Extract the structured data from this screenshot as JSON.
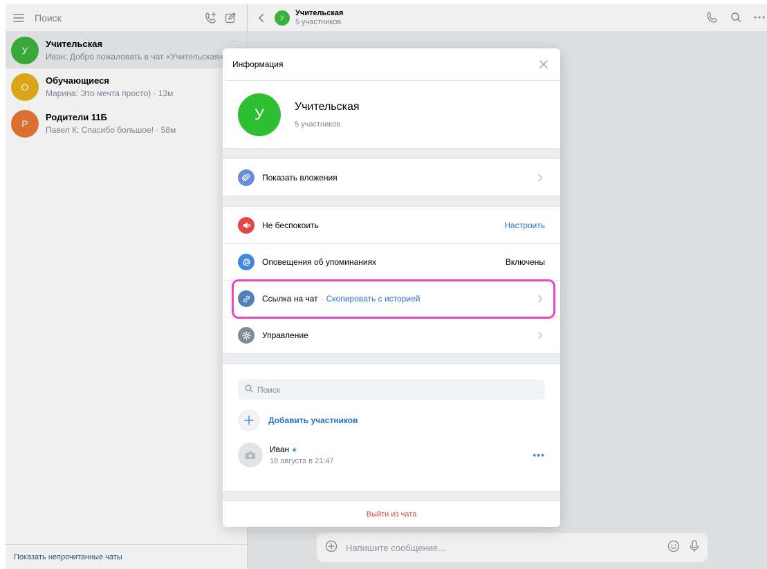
{
  "sidebar": {
    "search_placeholder": "Поиск",
    "chats": [
      {
        "name": "Учительская",
        "initial": "У",
        "color": "#3cb33c",
        "preview": "Иван: Добро пожаловать в чат «Учительская»",
        "more": "···"
      },
      {
        "name": "Обучающиеся",
        "initial": "О",
        "color": "#e6b11a",
        "preview": "Марина: Это мечта просто) · 13м"
      },
      {
        "name": "Родители 11Б",
        "initial": "Р",
        "color": "#e57735",
        "preview": "Павел К: Спасибо большое! · 58м"
      }
    ],
    "show_unread": "Показать непрочитанные чаты"
  },
  "header": {
    "title": "Учительская",
    "subtitle": "5 участников",
    "avatar_initial": "У"
  },
  "composer": {
    "placeholder": "Напишите сообщение..."
  },
  "modal": {
    "title": "Информация",
    "profile": {
      "initial": "У",
      "name": "Учительская",
      "subtitle": "5 участников"
    },
    "attachments_label": "Показать вложения",
    "dnd": {
      "label": "Не беспокоить",
      "value": "Настроить"
    },
    "mentions": {
      "label": "Оповещения об упоминаниях",
      "value": "Включены"
    },
    "chat_link": {
      "label": "Ссылка на чат",
      "separator": "·",
      "link": "Скопировать с историей"
    },
    "manage_label": "Управление",
    "members": {
      "search_placeholder": "Поиск",
      "add_label": "Добавить участников",
      "list": [
        {
          "name": "Иван",
          "star": "★",
          "date": "18 августа в 21:47",
          "more": "•••"
        }
      ]
    },
    "leave_label": "Выйти из чата"
  },
  "colors": {
    "accent": "#2a6fc9",
    "highlight": "#f043c8",
    "danger": "#e64646",
    "dnd_icon": "#e64646",
    "link_icon": "#5181b8",
    "mention_icon": "#3f8ae0",
    "manage_icon": "#818c99"
  }
}
